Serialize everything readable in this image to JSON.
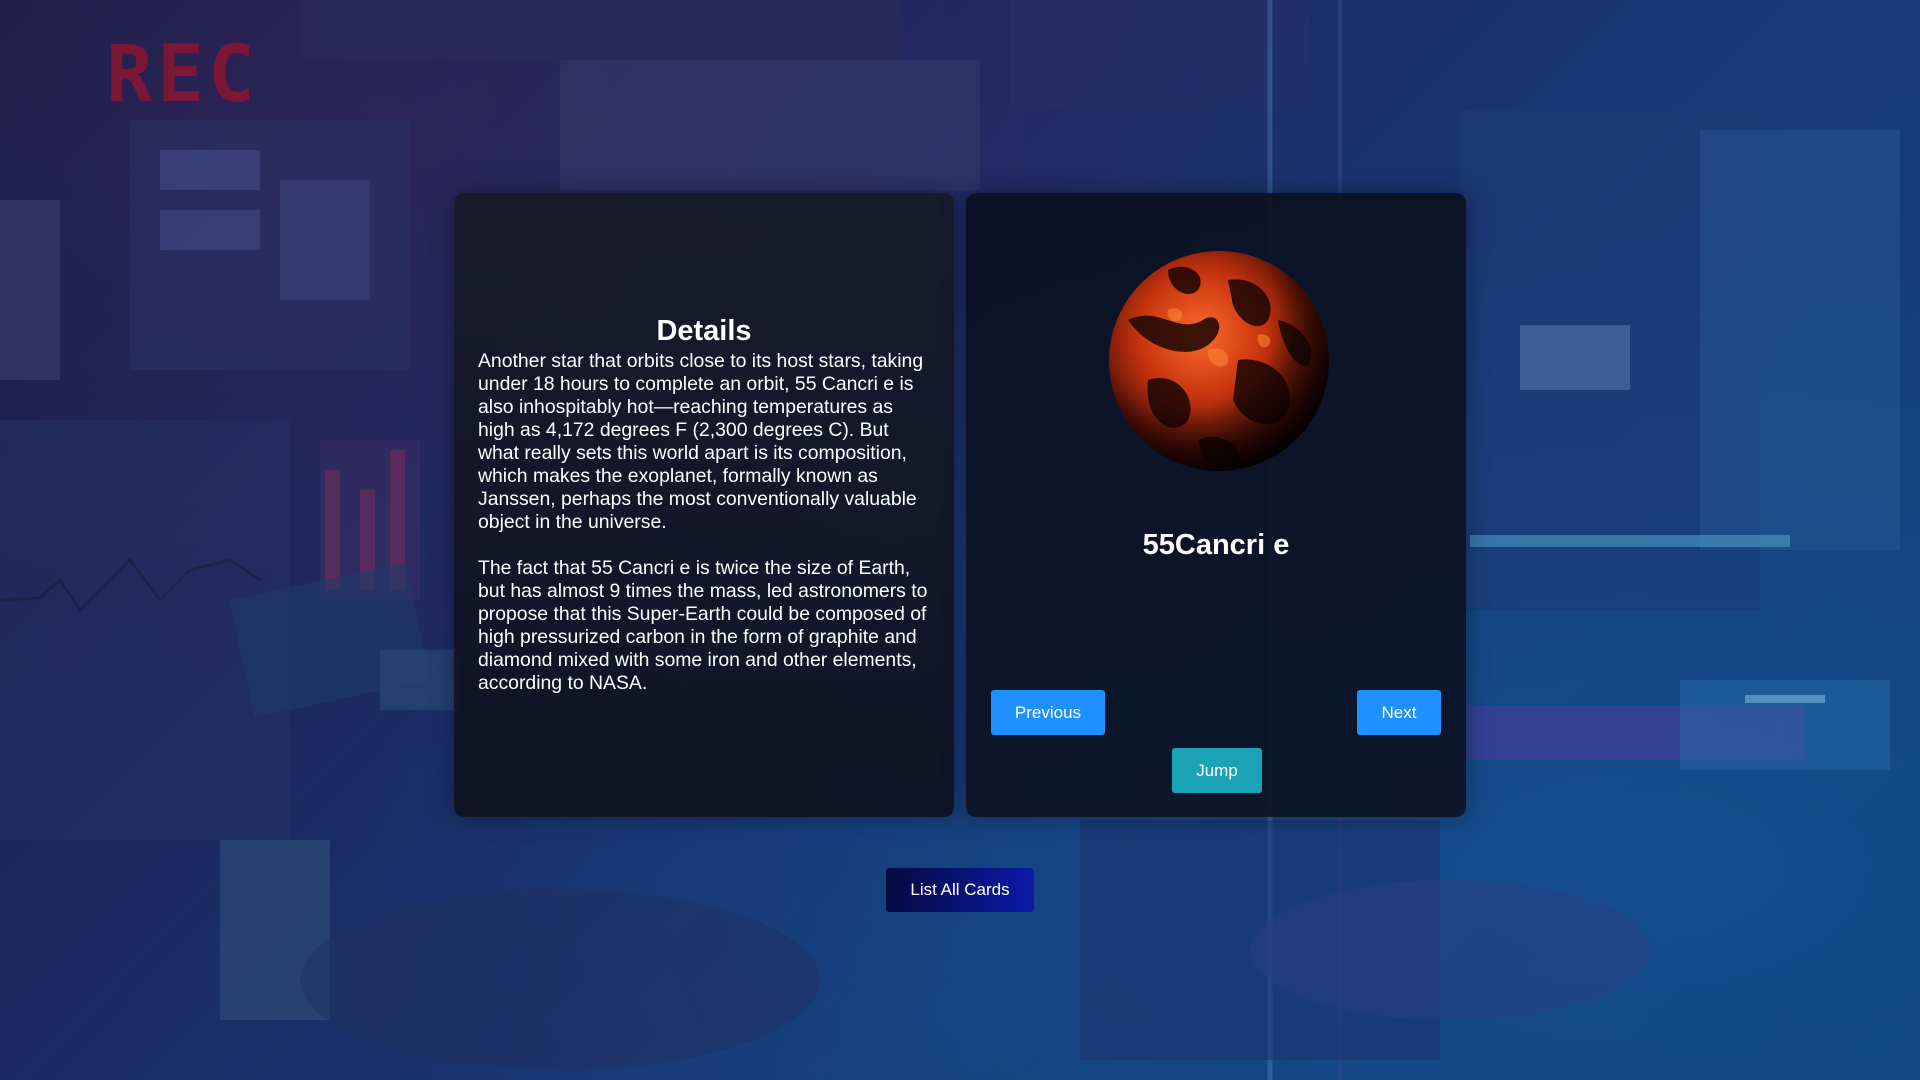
{
  "background": {
    "rec_label": "REC"
  },
  "details": {
    "title": "Details",
    "paragraphs": [
      "Another star that orbits close to its host stars, taking under 18 hours to complete an orbit, 55 Cancri e is also inhospitably hot—reaching temperatures as high as 4,172 degrees F (2,300 degrees C). But what really sets this world apart is its composition, which makes the exoplanet, formally known as Janssen, perhaps the most conventionally valuable object in the universe.",
      "The fact that 55 Cancri e is twice the size of Earth, but has almost 9 times the mass, led astronomers to propose that this Super-Earth could be composed of high pressurized carbon in the form of graphite and diamond mixed with some iron and other elements, according to NASA."
    ]
  },
  "card": {
    "planet_name": "55Cancri e",
    "planet_image_icon": "lava-planet-image",
    "previous_label": "Previous",
    "next_label": "Next",
    "jump_label": "Jump"
  },
  "footer": {
    "list_all_label": "List All Cards"
  },
  "colors": {
    "primary_button": "#1e90ff",
    "jump_button": "#1aa3b5",
    "list_button_start": "#040a40",
    "list_button_end": "#0a1aa8",
    "rec_label": "#8c1432"
  }
}
